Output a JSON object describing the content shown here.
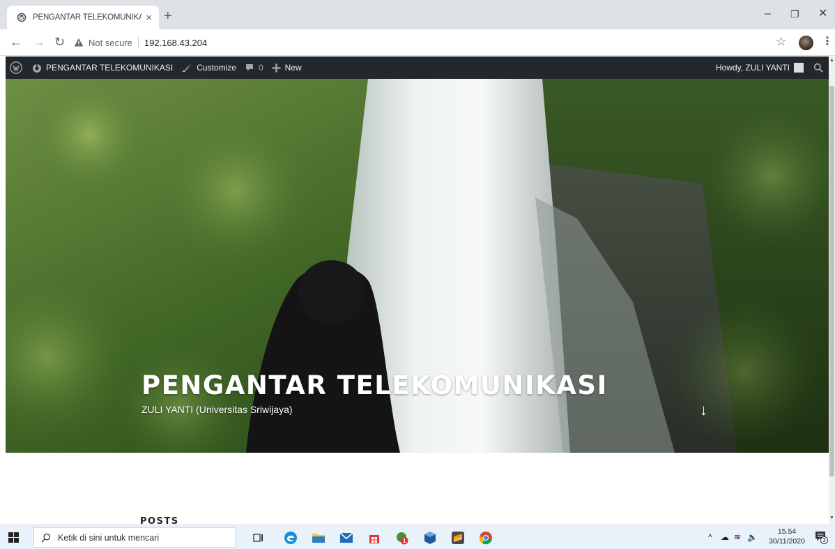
{
  "browser": {
    "tab_title": "PENGANTAR TELEKOMUNIKASI -",
    "tab_close": "×",
    "new_tab": "+",
    "security_label": "Not secure",
    "url": "192.168.43.204",
    "window_controls": {
      "minimize": "–",
      "restore": "❐",
      "close": "✕"
    }
  },
  "admin_bar": {
    "site_name": "PENGANTAR TELEKOMUNIKASI",
    "customize": "Customize",
    "comments_count": "0",
    "new_label": "New",
    "howdy": "Howdy, ZULI YANTI"
  },
  "hero": {
    "site_title": "PENGANTAR TELEKOMUNIKASI",
    "site_description": "ZULI YANTI (Universitas Sriwijaya)",
    "scroll_arrow": "↓"
  },
  "content": {
    "posts_heading": "POSTS"
  },
  "taskbar": {
    "search_placeholder": "Ketik di sini untuk mencari",
    "time": "15.54",
    "date": "30/11/2020",
    "notification_count": "3",
    "store_badge": "1",
    "apps": [
      "task-view-icon",
      "edge-icon",
      "file-explorer-icon",
      "mail-icon",
      "store-icon",
      "app-orange-icon",
      "virtualbox-icon",
      "sublime-icon",
      "chrome-icon"
    ]
  },
  "colors": {
    "admin_bar_bg": "#23282d",
    "tabstrip_bg": "#dee1e6",
    "taskbar_bg": "#e9f1fb"
  }
}
